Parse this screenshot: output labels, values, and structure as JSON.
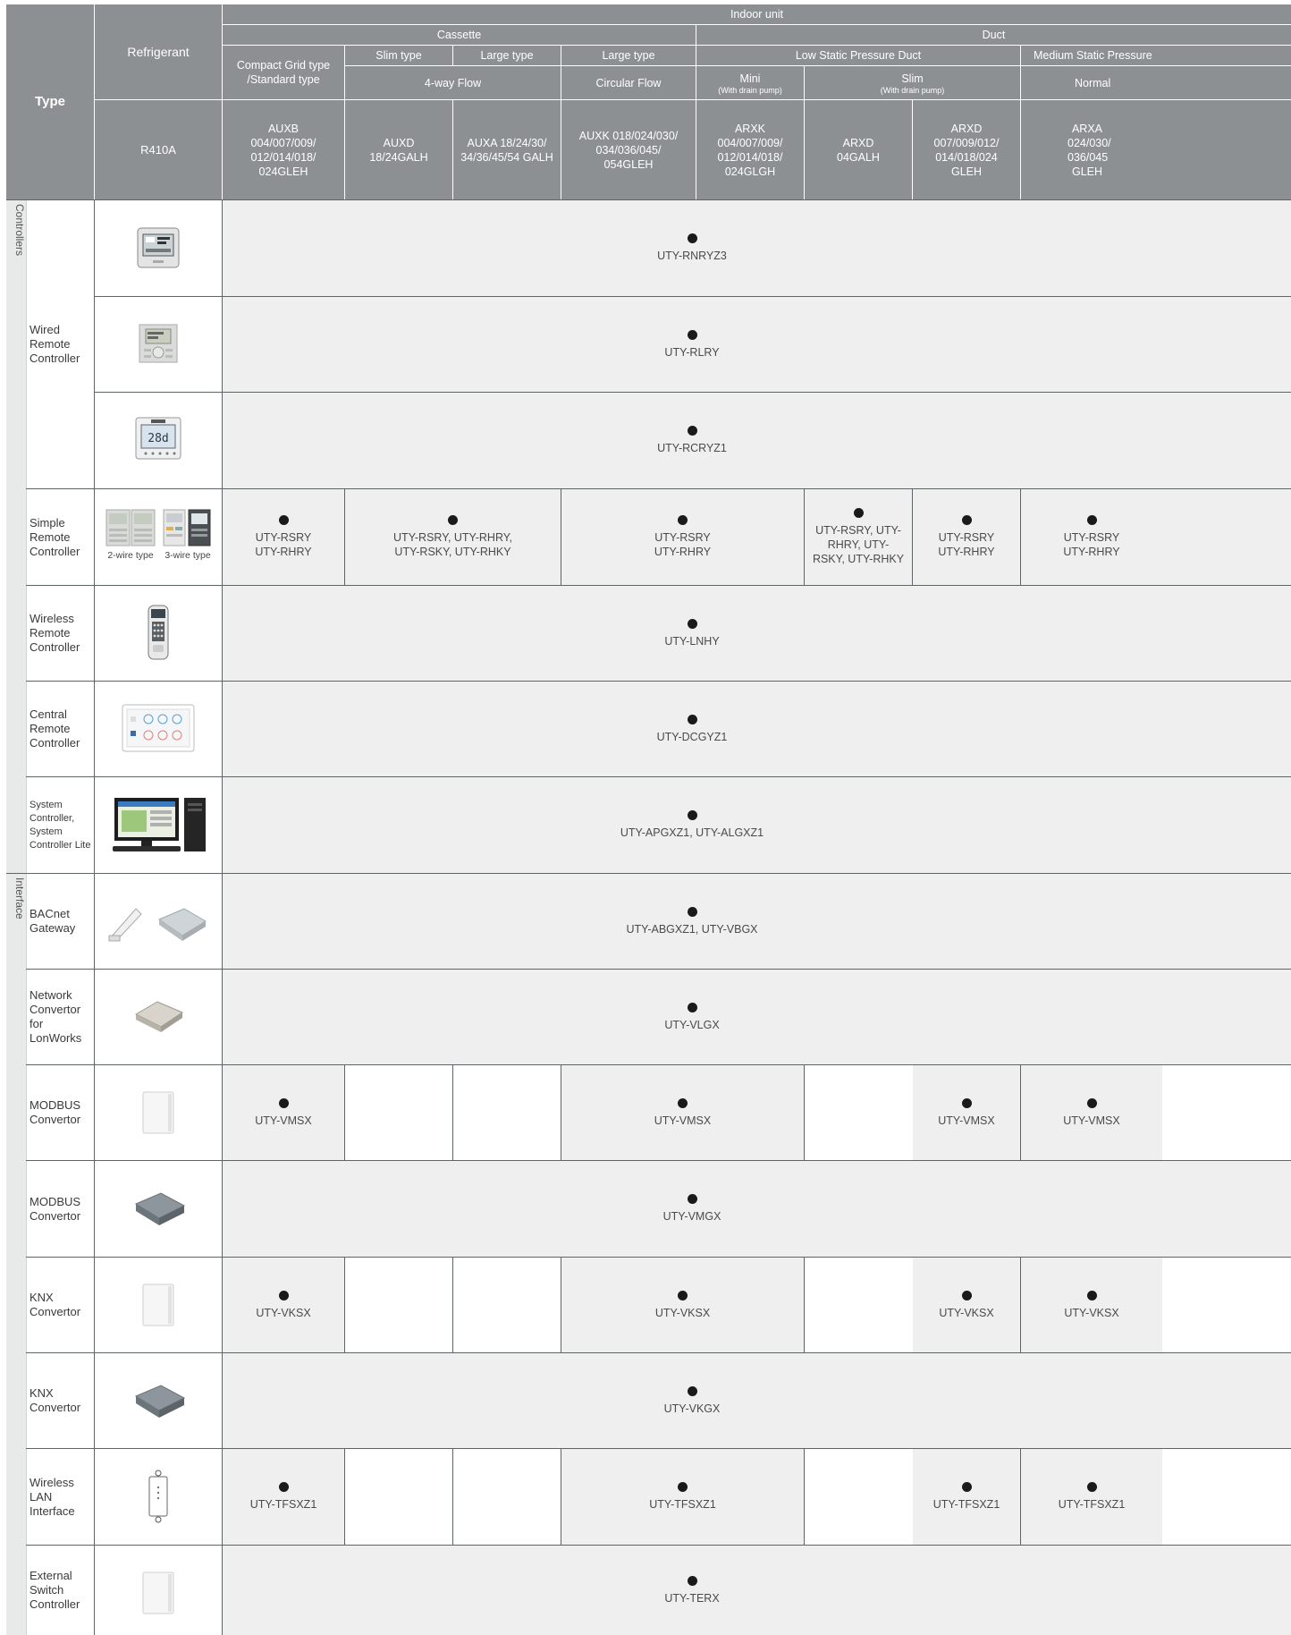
{
  "header": {
    "type": "Type",
    "refrigerant": "Refrigerant",
    "refrigerant_value": "R410A",
    "indoor_unit": "Indoor unit",
    "cassette": "Cassette",
    "duct": "Duct",
    "compact": "Compact Grid type /Standard type",
    "slim_type": "Slim type",
    "large_type_1": "Large type",
    "large_type_2": "Large type",
    "four_way_flow": "4-way Flow",
    "circular_flow": "Circular Flow",
    "low_static": "Low Static Pressure Duct",
    "medium_static": "Medium Static  Pressure",
    "mini": "Mini",
    "mini_sub": "(With drain pump)",
    "slim": "Slim",
    "slim_sub": "(With drain pump)",
    "normal": "Normal",
    "models": [
      "AUXB 004/007/009/ 012/014/018/ 024GLEH",
      "AUXD 18/24GALH",
      "AUXA 18/24/30/ 34/36/45/54 GALH",
      "AUXK 018/024/030/ 034/036/045/ 054GLEH",
      "ARXK 004/007/009/ 012/014/018/ 024GLGH",
      "ARXD 04GALH",
      "ARXD 007/009/012/ 014/018/024 GLEH",
      "ARXA 024/030/ 036/045 GLEH"
    ]
  },
  "groups": {
    "controllers": "Controllers",
    "interface": "Interface"
  },
  "labels": {
    "wired": "Wired Remote Controller",
    "simple": "Simple Remote Controller",
    "wireless": "Wireless Remote Controller",
    "central": "Central Remote Controller",
    "system": "System Controller, System Controller Lite",
    "bacnet": "BACnet Gateway",
    "network": "Network Convertor for LonWorks",
    "modbus1": "MODBUS Convertor",
    "modbus2": "MODBUS Convertor",
    "knx1": "KNX Convertor",
    "knx2": "KNX Convertor",
    "wlan": "Wireless LAN Interface",
    "external": "External Switch Controller"
  },
  "captions": {
    "two_wire": "2-wire type",
    "three_wire": "3-wire type"
  },
  "rows": {
    "r1": "UTY-RNRYZ3",
    "r2": "UTY-RLRY",
    "r3": "UTY-RCRYZ1",
    "simple": [
      "UTY-RSRY UTY-RHRY",
      "UTY-RSRY, UTY-RHRY, UTY-RSKY, UTY-RHKY",
      "UTY-RSRY UTY-RHRY",
      "UTY-RSRY, UTY-RHRY, UTY-RSKY, UTY-RHKY",
      "UTY-RSRY UTY-RHRY",
      "UTY-RSRY UTY-RHRY"
    ],
    "wireless": "UTY-LNHY",
    "central": "UTY-DCGYZ1",
    "system": "UTY-APGXZ1, UTY-ALGXZ1",
    "bacnet": "UTY-ABGXZ1, UTY-VBGX",
    "network": "UTY-VLGX",
    "modbus1": [
      "UTY-VMSX",
      "UTY-VMSX",
      "UTY-VMSX",
      "UTY-VMSX"
    ],
    "modbus2": "UTY-VMGX",
    "knx1": [
      "UTY-VKSX",
      "UTY-VKSX",
      "UTY-VKSX",
      "UTY-VKSX"
    ],
    "knx2": "UTY-VKGX",
    "wlan": [
      "UTY-TFSXZ1",
      "UTY-TFSXZ1",
      "UTY-TFSXZ1",
      "UTY-TFSXZ1"
    ],
    "external": "UTY-TERX"
  },
  "colors": {
    "header": "#8c9092",
    "row_bg": "#efefef",
    "grid": "#5f6466"
  }
}
